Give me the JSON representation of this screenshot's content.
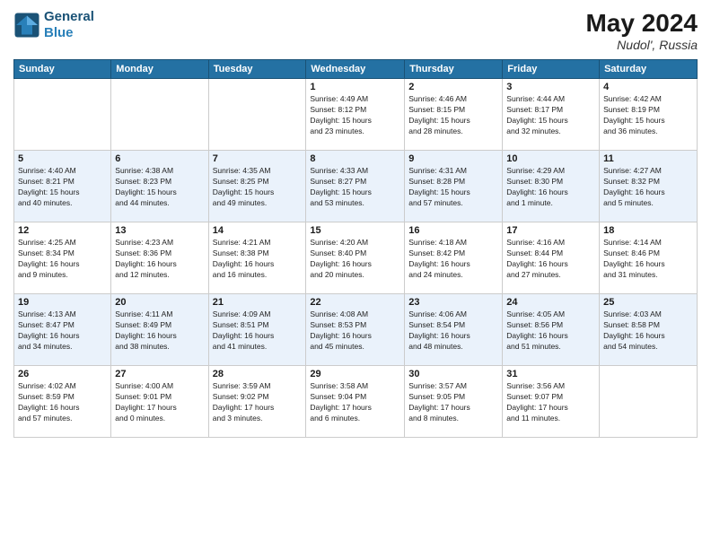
{
  "header": {
    "logo_line1": "General",
    "logo_line2": "Blue",
    "month": "May 2024",
    "location": "Nudol', Russia"
  },
  "days_of_week": [
    "Sunday",
    "Monday",
    "Tuesday",
    "Wednesday",
    "Thursday",
    "Friday",
    "Saturday"
  ],
  "weeks": [
    [
      {
        "day": "",
        "info": ""
      },
      {
        "day": "",
        "info": ""
      },
      {
        "day": "",
        "info": ""
      },
      {
        "day": "1",
        "info": "Sunrise: 4:49 AM\nSunset: 8:12 PM\nDaylight: 15 hours\nand 23 minutes."
      },
      {
        "day": "2",
        "info": "Sunrise: 4:46 AM\nSunset: 8:15 PM\nDaylight: 15 hours\nand 28 minutes."
      },
      {
        "day": "3",
        "info": "Sunrise: 4:44 AM\nSunset: 8:17 PM\nDaylight: 15 hours\nand 32 minutes."
      },
      {
        "day": "4",
        "info": "Sunrise: 4:42 AM\nSunset: 8:19 PM\nDaylight: 15 hours\nand 36 minutes."
      }
    ],
    [
      {
        "day": "5",
        "info": "Sunrise: 4:40 AM\nSunset: 8:21 PM\nDaylight: 15 hours\nand 40 minutes."
      },
      {
        "day": "6",
        "info": "Sunrise: 4:38 AM\nSunset: 8:23 PM\nDaylight: 15 hours\nand 44 minutes."
      },
      {
        "day": "7",
        "info": "Sunrise: 4:35 AM\nSunset: 8:25 PM\nDaylight: 15 hours\nand 49 minutes."
      },
      {
        "day": "8",
        "info": "Sunrise: 4:33 AM\nSunset: 8:27 PM\nDaylight: 15 hours\nand 53 minutes."
      },
      {
        "day": "9",
        "info": "Sunrise: 4:31 AM\nSunset: 8:28 PM\nDaylight: 15 hours\nand 57 minutes."
      },
      {
        "day": "10",
        "info": "Sunrise: 4:29 AM\nSunset: 8:30 PM\nDaylight: 16 hours\nand 1 minute."
      },
      {
        "day": "11",
        "info": "Sunrise: 4:27 AM\nSunset: 8:32 PM\nDaylight: 16 hours\nand 5 minutes."
      }
    ],
    [
      {
        "day": "12",
        "info": "Sunrise: 4:25 AM\nSunset: 8:34 PM\nDaylight: 16 hours\nand 9 minutes."
      },
      {
        "day": "13",
        "info": "Sunrise: 4:23 AM\nSunset: 8:36 PM\nDaylight: 16 hours\nand 12 minutes."
      },
      {
        "day": "14",
        "info": "Sunrise: 4:21 AM\nSunset: 8:38 PM\nDaylight: 16 hours\nand 16 minutes."
      },
      {
        "day": "15",
        "info": "Sunrise: 4:20 AM\nSunset: 8:40 PM\nDaylight: 16 hours\nand 20 minutes."
      },
      {
        "day": "16",
        "info": "Sunrise: 4:18 AM\nSunset: 8:42 PM\nDaylight: 16 hours\nand 24 minutes."
      },
      {
        "day": "17",
        "info": "Sunrise: 4:16 AM\nSunset: 8:44 PM\nDaylight: 16 hours\nand 27 minutes."
      },
      {
        "day": "18",
        "info": "Sunrise: 4:14 AM\nSunset: 8:46 PM\nDaylight: 16 hours\nand 31 minutes."
      }
    ],
    [
      {
        "day": "19",
        "info": "Sunrise: 4:13 AM\nSunset: 8:47 PM\nDaylight: 16 hours\nand 34 minutes."
      },
      {
        "day": "20",
        "info": "Sunrise: 4:11 AM\nSunset: 8:49 PM\nDaylight: 16 hours\nand 38 minutes."
      },
      {
        "day": "21",
        "info": "Sunrise: 4:09 AM\nSunset: 8:51 PM\nDaylight: 16 hours\nand 41 minutes."
      },
      {
        "day": "22",
        "info": "Sunrise: 4:08 AM\nSunset: 8:53 PM\nDaylight: 16 hours\nand 45 minutes."
      },
      {
        "day": "23",
        "info": "Sunrise: 4:06 AM\nSunset: 8:54 PM\nDaylight: 16 hours\nand 48 minutes."
      },
      {
        "day": "24",
        "info": "Sunrise: 4:05 AM\nSunset: 8:56 PM\nDaylight: 16 hours\nand 51 minutes."
      },
      {
        "day": "25",
        "info": "Sunrise: 4:03 AM\nSunset: 8:58 PM\nDaylight: 16 hours\nand 54 minutes."
      }
    ],
    [
      {
        "day": "26",
        "info": "Sunrise: 4:02 AM\nSunset: 8:59 PM\nDaylight: 16 hours\nand 57 minutes."
      },
      {
        "day": "27",
        "info": "Sunrise: 4:00 AM\nSunset: 9:01 PM\nDaylight: 17 hours\nand 0 minutes."
      },
      {
        "day": "28",
        "info": "Sunrise: 3:59 AM\nSunset: 9:02 PM\nDaylight: 17 hours\nand 3 minutes."
      },
      {
        "day": "29",
        "info": "Sunrise: 3:58 AM\nSunset: 9:04 PM\nDaylight: 17 hours\nand 6 minutes."
      },
      {
        "day": "30",
        "info": "Sunrise: 3:57 AM\nSunset: 9:05 PM\nDaylight: 17 hours\nand 8 minutes."
      },
      {
        "day": "31",
        "info": "Sunrise: 3:56 AM\nSunset: 9:07 PM\nDaylight: 17 hours\nand 11 minutes."
      },
      {
        "day": "",
        "info": ""
      }
    ]
  ]
}
